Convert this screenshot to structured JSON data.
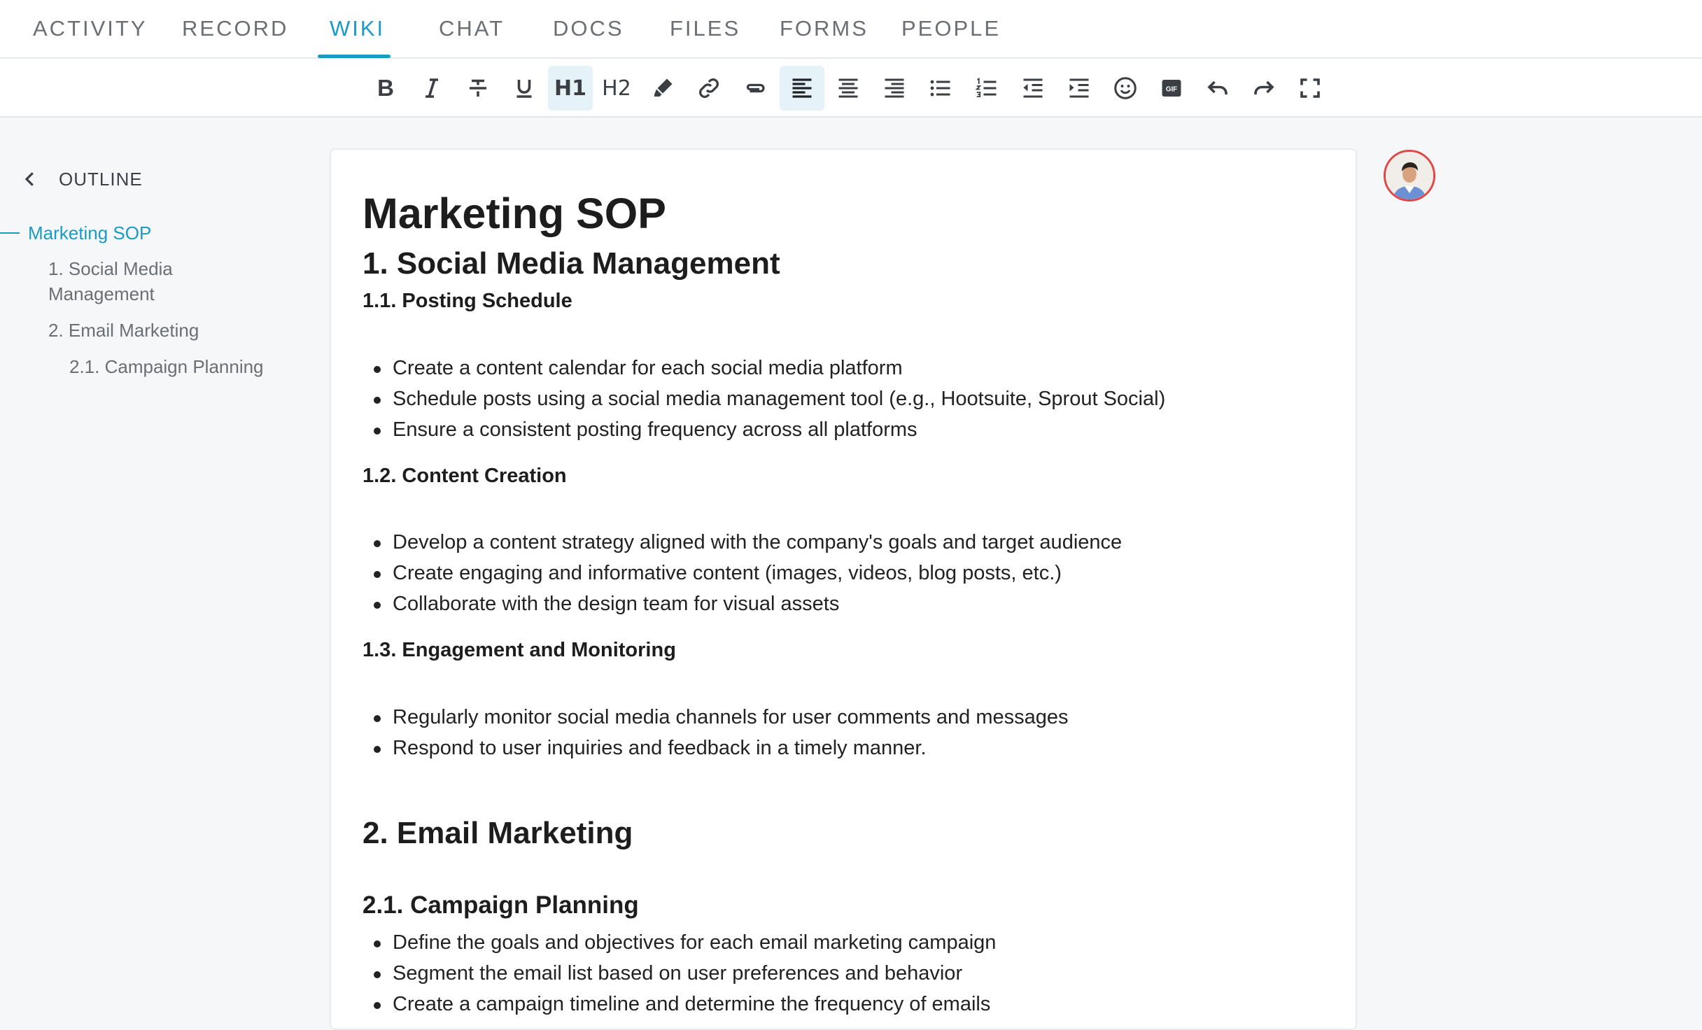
{
  "tabs": [
    {
      "label": "ACTIVITY",
      "active": false
    },
    {
      "label": "RECORD",
      "active": false
    },
    {
      "label": "WIKI",
      "active": true
    },
    {
      "label": "CHAT",
      "active": false
    },
    {
      "label": "DOCS",
      "active": false
    },
    {
      "label": "FILES",
      "active": false
    },
    {
      "label": "FORMS",
      "active": false
    },
    {
      "label": "PEOPLE",
      "active": false
    }
  ],
  "toolbar": {
    "bold_label": "B",
    "h1_label": "H1",
    "h2_label": "H2",
    "active_buttons": [
      "heading-1",
      "align-left"
    ],
    "icons": [
      "bold-icon",
      "italic-icon",
      "strikethrough-icon",
      "underline-icon",
      "heading-1-icon",
      "heading-2-icon",
      "highlight-icon",
      "link-icon",
      "attachment-icon",
      "align-left-icon",
      "align-center-icon",
      "align-right-icon",
      "bullet-list-icon",
      "numbered-list-icon",
      "outdent-icon",
      "indent-icon",
      "emoji-icon",
      "gif-icon",
      "undo-icon",
      "redo-icon",
      "fullscreen-icon"
    ],
    "gif_label": "GIF"
  },
  "outline": {
    "header": "OUTLINE",
    "items": [
      {
        "label": "Marketing SOP",
        "level": 0,
        "active": true
      },
      {
        "label": "1. Social Media",
        "label2": "Management",
        "level": 1,
        "active": false
      },
      {
        "label": "2. Email Marketing",
        "level": 1,
        "active": false
      },
      {
        "label": "2.1. Campaign Planning",
        "level": 2,
        "active": false
      }
    ]
  },
  "document": {
    "title": "Marketing SOP",
    "sections": [
      {
        "heading": "1. Social Media Management",
        "subsections": [
          {
            "heading": "1.1. Posting Schedule",
            "bullets": [
              "Create a content calendar for each social media platform",
              "Schedule posts using a social media management tool (e.g., Hootsuite, Sprout Social)",
              "Ensure a consistent posting frequency across all platforms"
            ]
          },
          {
            "heading": "1.2. Content Creation",
            "bullets": [
              "Develop a content strategy aligned with the company's goals and target audience",
              "Create engaging and informative content (images, videos, blog posts, etc.)",
              "Collaborate with the design team for visual assets"
            ]
          },
          {
            "heading": "1.3. Engagement and Monitoring",
            "bullets": [
              "Regularly monitor social media channels for user comments and messages",
              "Respond to user inquiries and feedback in a timely manner."
            ]
          }
        ]
      },
      {
        "heading": "2. Email Marketing",
        "subsections": [
          {
            "heading": "2.1. Campaign Planning",
            "bullets": [
              "Define the goals and objectives for each email marketing campaign",
              "Segment the email list based on user preferences and behavior",
              " Create a campaign timeline and determine the frequency of emails"
            ]
          }
        ]
      }
    ]
  },
  "colors": {
    "accent": "#1b9bc4",
    "avatar_ring": "#e04848",
    "active_button_bg": "#e5f2f7"
  }
}
